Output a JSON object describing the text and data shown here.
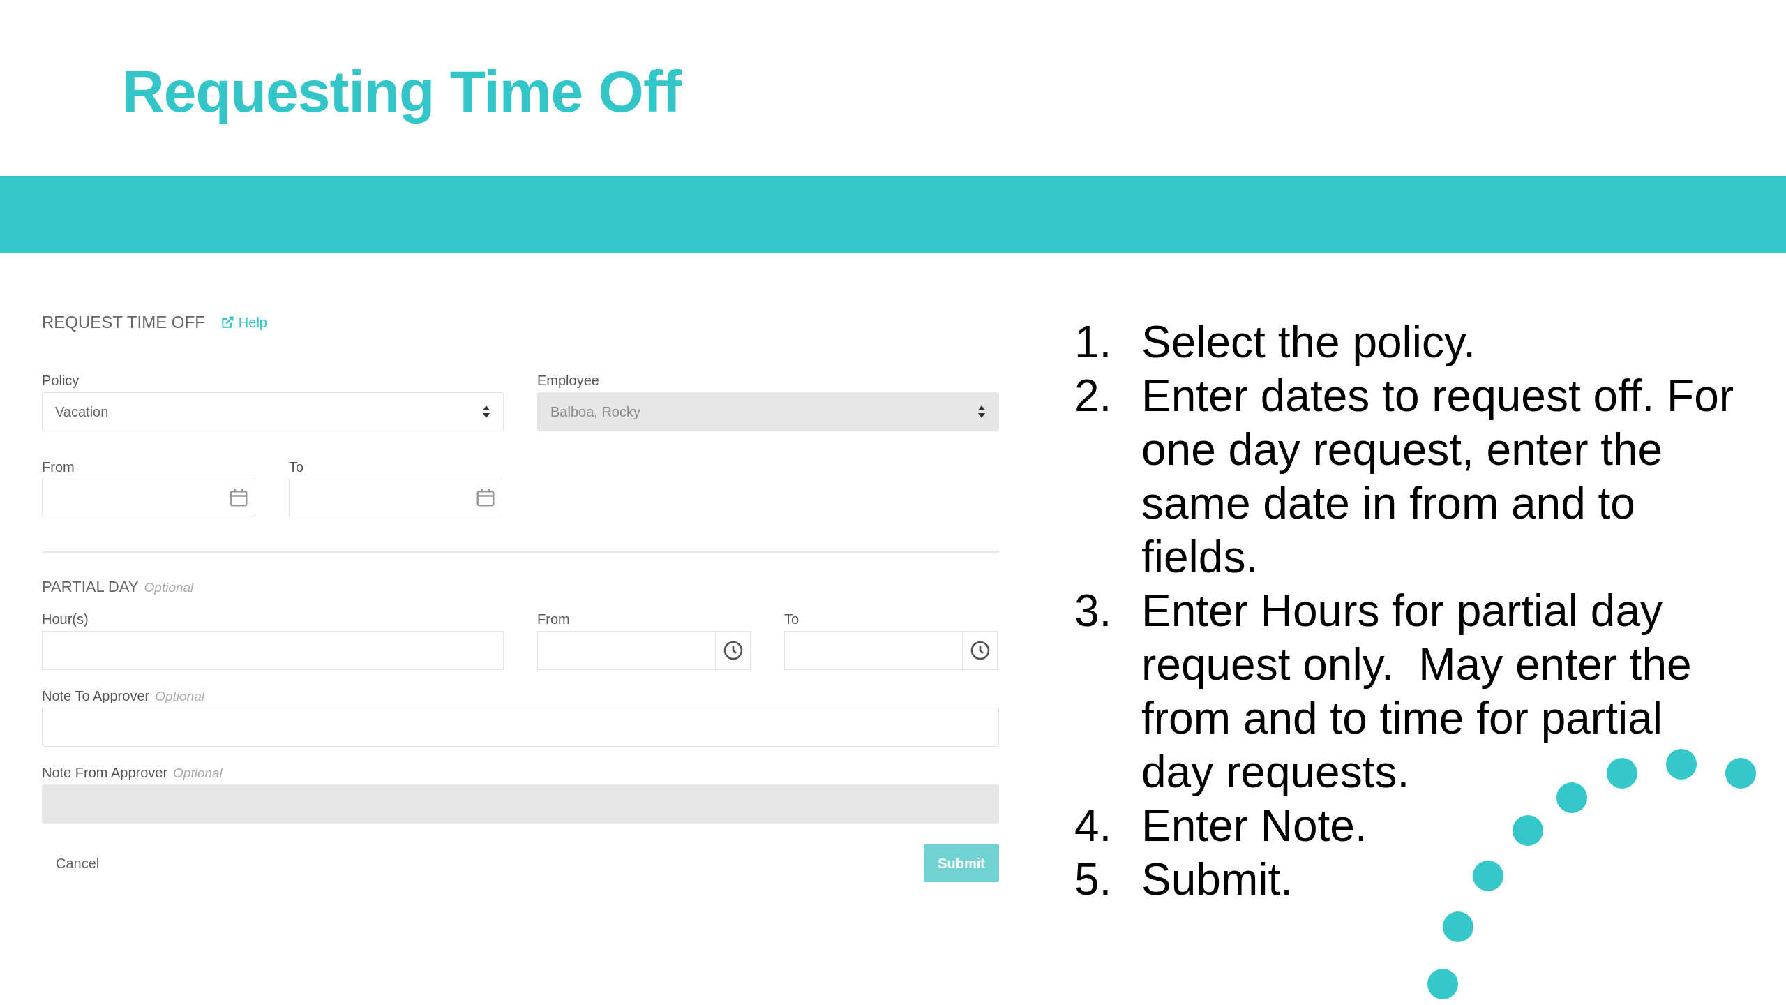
{
  "slide": {
    "title": "Requesting Time Off"
  },
  "form": {
    "heading": "REQUEST TIME OFF",
    "help_link": "Help",
    "policy": {
      "label": "Policy",
      "value": "Vacation",
      "disabled": false
    },
    "employee": {
      "label": "Employee",
      "value": "Balboa, Rocky",
      "disabled": true
    },
    "date_from": {
      "label": "From"
    },
    "date_to": {
      "label": "To"
    },
    "partial_day": {
      "heading": "PARTIAL DAY",
      "hint": "Optional"
    },
    "hours": {
      "label": "Hour(s)"
    },
    "time_from": {
      "label": "From"
    },
    "time_to": {
      "label": "To"
    },
    "note_to_approver": {
      "label": "Note To Approver",
      "hint": "Optional",
      "disabled": false
    },
    "note_from_approver": {
      "label": "Note From Approver",
      "hint": "Optional",
      "disabled": true
    },
    "cancel": "Cancel",
    "submit": {
      "label": "Submit",
      "disabled": true
    }
  },
  "steps": [
    {
      "number": "1.",
      "text": "Select the policy."
    },
    {
      "number": "2.",
      "text": "Enter dates to request off. For one day request, enter the same date in from and to fields."
    },
    {
      "number": "3.",
      "text": "Enter Hours for partial day request only.  May enter the from and to time for partial day requests."
    },
    {
      "number": "4.",
      "text": "Enter Note."
    },
    {
      "number": "5.",
      "text": "Submit."
    }
  ]
}
